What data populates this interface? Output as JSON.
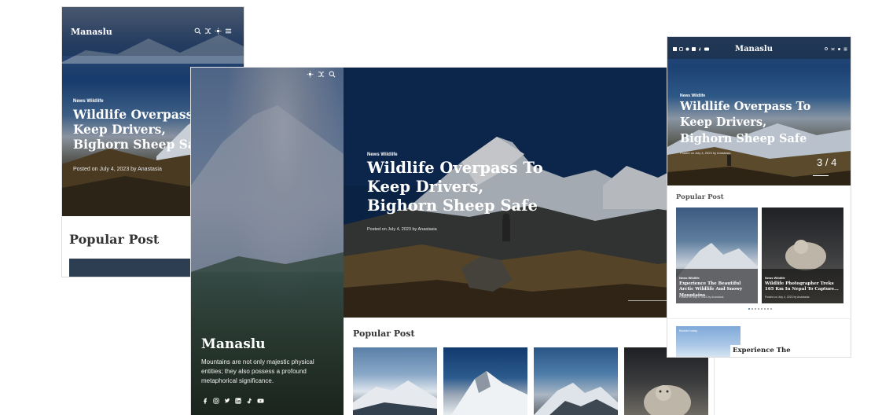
{
  "site": {
    "name": "Manaslu",
    "tagline": "Mountains are not only majestic physical entities; they also possess a profound metaphorical significance."
  },
  "hero": {
    "category": "News Wildlife",
    "title_lines": [
      "Wildlife Overpass To",
      "Keep Drivers,",
      "Bighorn Sheep Safe"
    ],
    "meta": "Posted on July 4, 2023 by Anastasia",
    "slide_counter": "3 / 4"
  },
  "popular": {
    "heading": "Popular Post",
    "cards": [
      {
        "category": "News Wildlife",
        "title": "Experience The Beautiful Arctic Wildlife And Snowy Mountains",
        "meta": "Posted on July 4, 2023 by Anastasia"
      },
      {
        "category": "News Wildlife",
        "title": "Wildlife Photographer Treks 165 Km In Nepal To Capture...",
        "meta": "Posted on July 4, 2023 by Anastasia"
      }
    ],
    "teaser_title": "Experience The",
    "teaser_badge": "Bucket today"
  },
  "icons": {
    "header": [
      "search-icon",
      "shuffle-icon",
      "theme-toggle-icon",
      "menu-icon"
    ],
    "social": [
      "facebook-icon",
      "instagram-icon",
      "twitter-icon",
      "linkedin-icon",
      "tiktok-icon",
      "youtube-icon"
    ]
  },
  "colors": {
    "hero_text": "#ffffff",
    "accent_dark": "#1f2a3a"
  }
}
